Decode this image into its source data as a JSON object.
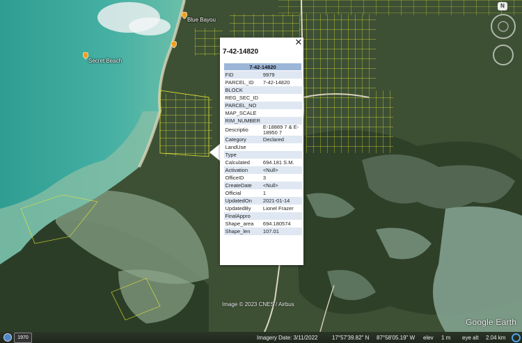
{
  "map": {
    "places": [
      {
        "name": "Secret Beach"
      },
      {
        "name": "Blue Bayou"
      }
    ],
    "copyright": "Image © 2023 CNES / Airbus",
    "logo": "Google Earth",
    "north_label": "N"
  },
  "balloon": {
    "title": "7-42-14820",
    "table_header": "7-42-14820",
    "close_symbol": "✕",
    "rows": [
      {
        "key": "FID",
        "value": "9979"
      },
      {
        "key": "PARCEL_ID",
        "value": "7-42-14820"
      },
      {
        "key": "BLOCK",
        "value": ""
      },
      {
        "key": "REG_SEC_ID",
        "value": ""
      },
      {
        "key": "PARCEL_NO",
        "value": ""
      },
      {
        "key": "MAP_SCALE",
        "value": ""
      },
      {
        "key": "RIM_NUMBER",
        "value": ""
      },
      {
        "key": "Descriptio",
        "value": "E-18889 7 & E-18950 7"
      },
      {
        "key": "Category",
        "value": "Declared"
      },
      {
        "key": "LandUse",
        "value": ""
      },
      {
        "key": "Type",
        "value": ""
      },
      {
        "key": "Calculated",
        "value": "694.181 S.M."
      },
      {
        "key": "Activation",
        "value": "<Null>"
      },
      {
        "key": "OfficeID",
        "value": "3"
      },
      {
        "key": "CreateDate",
        "value": "<Null>"
      },
      {
        "key": "Official",
        "value": "1"
      },
      {
        "key": "UpdatedOn",
        "value": "2021-01-14"
      },
      {
        "key": "UpdatedBy",
        "value": "Lionel Frazer"
      },
      {
        "key": "FinalAppro",
        "value": ""
      },
      {
        "key": "Shape_area",
        "value": "694.180574"
      },
      {
        "key": "Shape_len",
        "value": "107.01"
      }
    ]
  },
  "status": {
    "history_label": "1970",
    "imagery_date": "Imagery Date: 3/11/2022",
    "lat": "17°57'39.82\" N",
    "lon": "87°58'05.19\" W",
    "elev_label": "elev",
    "elev_value": "1 m",
    "eye_alt": "eye alt",
    "eye_alt_value": "2.04 km"
  },
  "colors": {
    "parcel_line": "#e8e832",
    "water": "#3fa89a",
    "land": "#3e5236"
  }
}
